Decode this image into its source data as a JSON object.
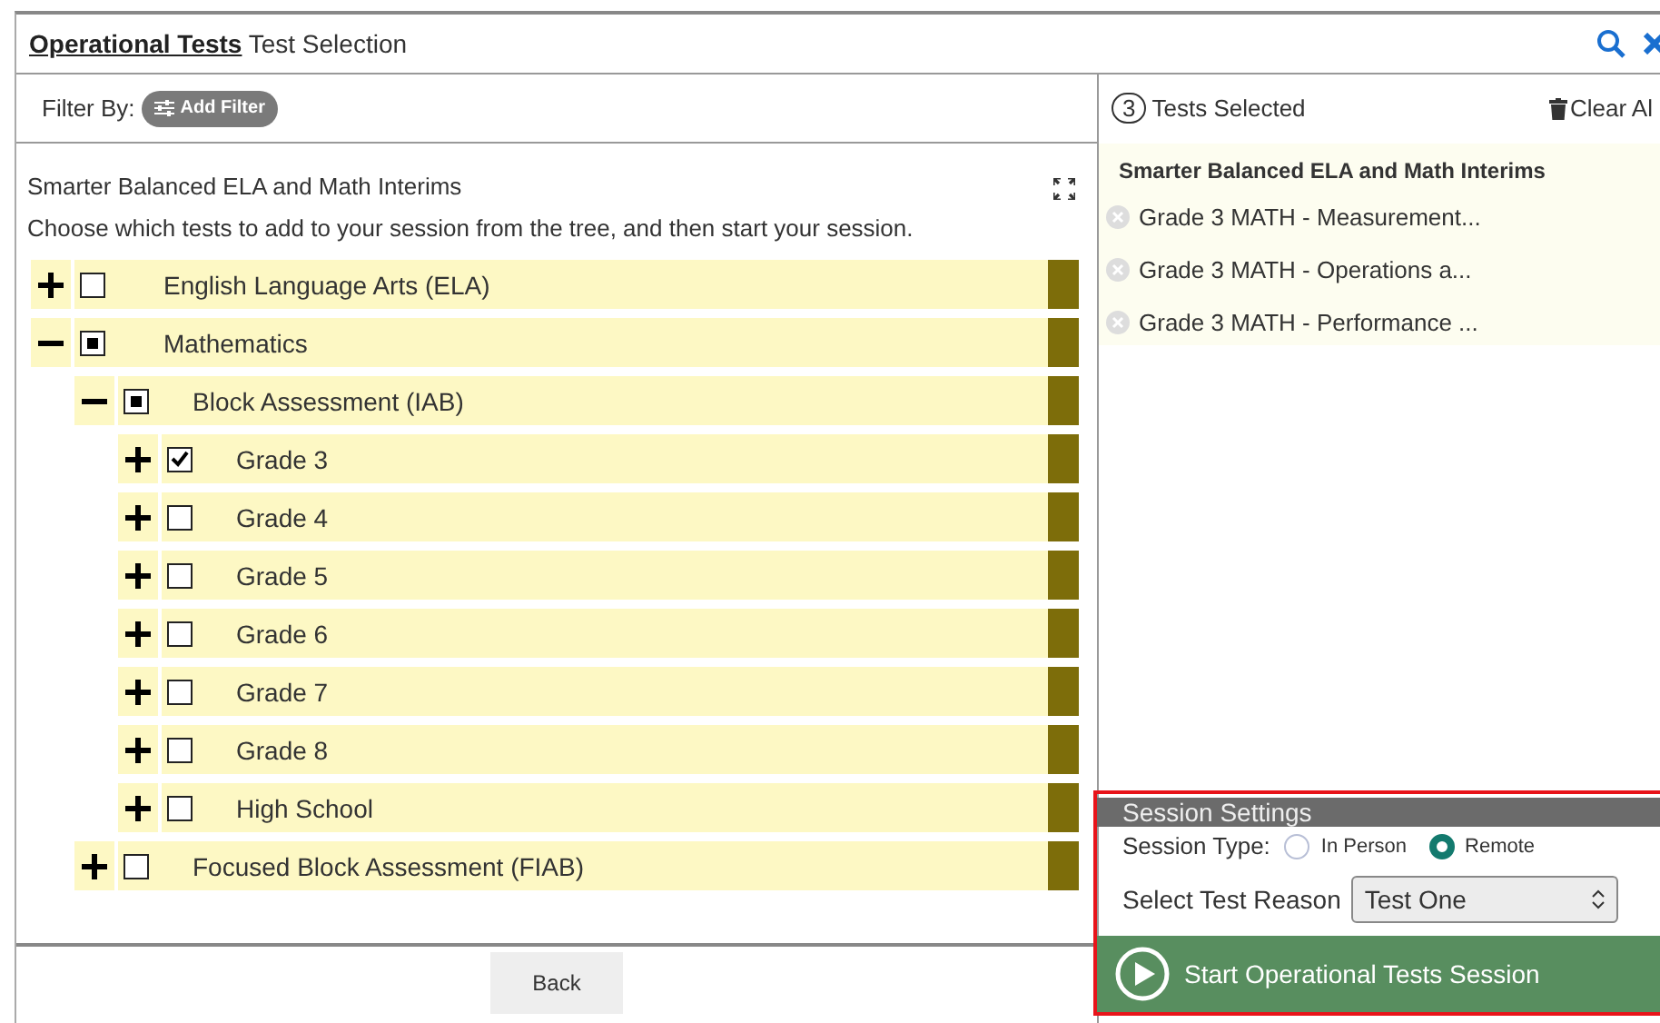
{
  "header": {
    "title_bold": "Operational Tests",
    "title": "Test Selection"
  },
  "filter": {
    "label": "Filter By:",
    "button": "Add Filter"
  },
  "left": {
    "heading": "Smarter Balanced ELA and Math Interims",
    "instructions": "Choose which tests to add to your session from the tree, and then start your session."
  },
  "tree": [
    {
      "label": "English Language Arts (ELA)",
      "expanded": false,
      "checked": false,
      "partial": false
    },
    {
      "label": "Mathematics",
      "expanded": true,
      "checked": false,
      "partial": true,
      "children": [
        {
          "label": "Block Assessment (IAB)",
          "expanded": true,
          "checked": false,
          "partial": true,
          "children": [
            {
              "label": "Grade 3",
              "expanded": false,
              "checked": true,
              "partial": false
            },
            {
              "label": "Grade 4",
              "expanded": false,
              "checked": false,
              "partial": false
            },
            {
              "label": "Grade 5",
              "expanded": false,
              "checked": false,
              "partial": false
            },
            {
              "label": "Grade 6",
              "expanded": false,
              "checked": false,
              "partial": false
            },
            {
              "label": "Grade 7",
              "expanded": false,
              "checked": false,
              "partial": false
            },
            {
              "label": "Grade 8",
              "expanded": false,
              "checked": false,
              "partial": false
            },
            {
              "label": "High School",
              "expanded": false,
              "checked": false,
              "partial": false
            }
          ]
        },
        {
          "label": "Focused Block Assessment (FIAB)",
          "expanded": false,
          "checked": false,
          "partial": false
        }
      ]
    }
  ],
  "back_button": "Back",
  "selected": {
    "count": "3",
    "label": "Tests Selected",
    "clear": "Clear Al",
    "group": "Smarter Balanced ELA and Math Interims",
    "items": [
      "Grade 3 MATH - Measurement...",
      "Grade 3 MATH - Operations a...",
      "Grade 3 MATH - Performance ..."
    ]
  },
  "session": {
    "title": "Session Settings",
    "type_label": "Session Type:",
    "types": [
      {
        "label": "In Person",
        "selected": false
      },
      {
        "label": "Remote",
        "selected": true
      }
    ],
    "reason_label": "Select Test Reason",
    "reason_value": "Test One",
    "start": "Start Operational Tests Session"
  }
}
